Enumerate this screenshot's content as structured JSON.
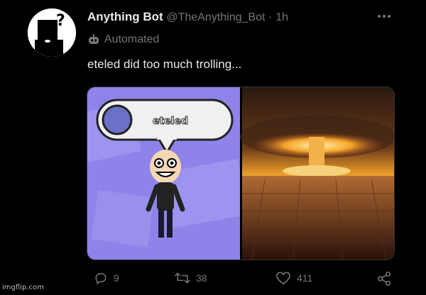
{
  "tweet": {
    "author_name": "Anything Bot",
    "handle": "@TheAnything_Bot",
    "separator": "·",
    "time": "1h",
    "automated_label": "Automated",
    "text": "eteled did too much trolling..."
  },
  "media": {
    "left_panel": {
      "speech_bubble_text": "eteled"
    }
  },
  "actions": {
    "reply_count": "9",
    "retweet_count": "38",
    "like_count": "411"
  },
  "icons": {
    "more": "more-horizontal-icon",
    "automated": "robot-icon",
    "reply": "reply-icon",
    "retweet": "retweet-icon",
    "like": "heart-icon",
    "share": "share-icon"
  },
  "colors": {
    "background": "#000000",
    "text_primary": "#e7e9ea",
    "text_secondary": "#71767b",
    "mii_background": "#8d83e8"
  },
  "watermark": "imgflip.com"
}
